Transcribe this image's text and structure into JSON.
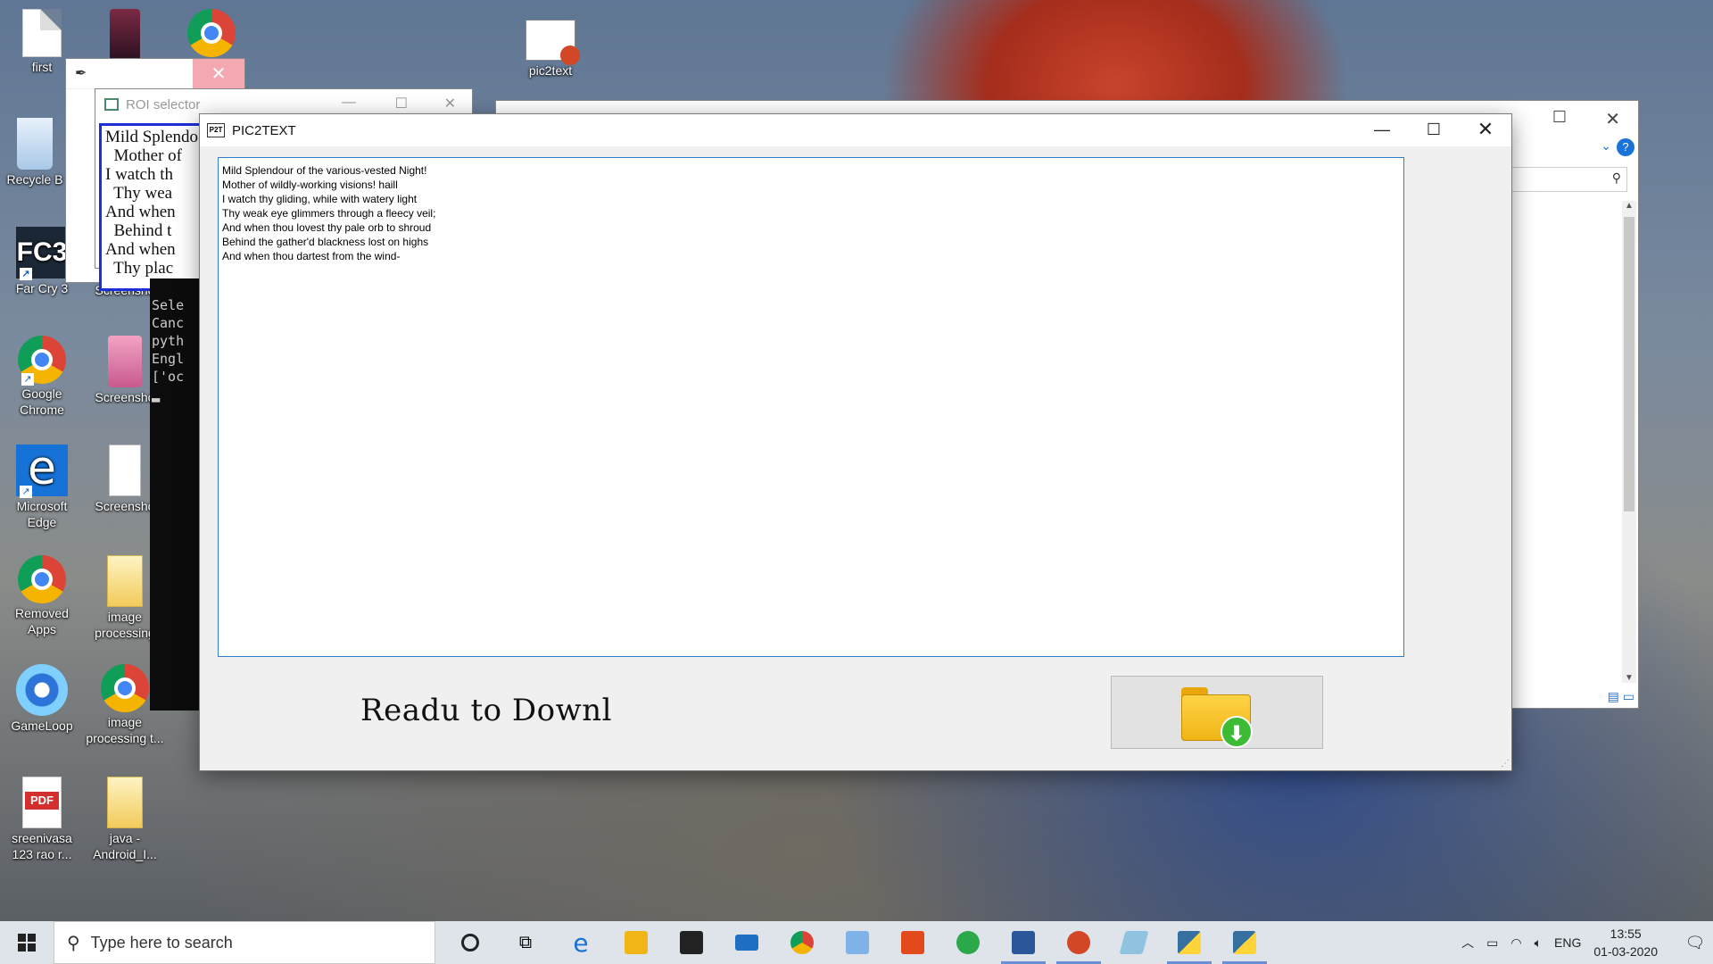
{
  "desktop": {
    "icons": [
      {
        "label": "first"
      },
      {
        "label": "Recycle B"
      },
      {
        "label": "Far Cry 3"
      },
      {
        "label": "Google Chrome"
      },
      {
        "label": "Microsoft Edge"
      },
      {
        "label": "Removed Apps"
      },
      {
        "label": "GameLoop"
      },
      {
        "label": "sreenivasa 123 rao r..."
      },
      {
        "label": "Screensho"
      },
      {
        "label": "Screensho"
      },
      {
        "label": "Screensho"
      },
      {
        "label": "image processing"
      },
      {
        "label": "image processing t..."
      },
      {
        "label": "java - Android_I..."
      },
      {
        "label": "pic2text"
      }
    ]
  },
  "roi_window": {
    "title": "ROI selector",
    "sample_lines": [
      "Mild Splendo",
      "  Mother of",
      "I watch th",
      "  Thy wea",
      "And when",
      "  Behind t",
      "And when",
      "  Thy plac"
    ]
  },
  "console": {
    "lines": [
      "Sele",
      "Canc",
      "pyth",
      "Engl",
      "['oc"
    ]
  },
  "app": {
    "title": "PIC2TEXT",
    "logo_text": "P2T",
    "text_lines": [
      "Mild Splendour of the various-vested Night!",
      "Mother of wildly-working visions! haill",
      "I watch thy gliding, while with watery light",
      "Thy weak eye glimmers through a fleecy veil;",
      "And when thou lovest thy pale orb to shroud",
      "Behind the gather'd blackness lost on highs",
      "And when thou dartest from the wind-"
    ],
    "status_text": "Readu to Downl",
    "download_icon": "folder-download-icon"
  },
  "taskbar": {
    "search_placeholder": "Type here to search",
    "language": "ENG",
    "time": "13:55",
    "date": "01-03-2020"
  }
}
